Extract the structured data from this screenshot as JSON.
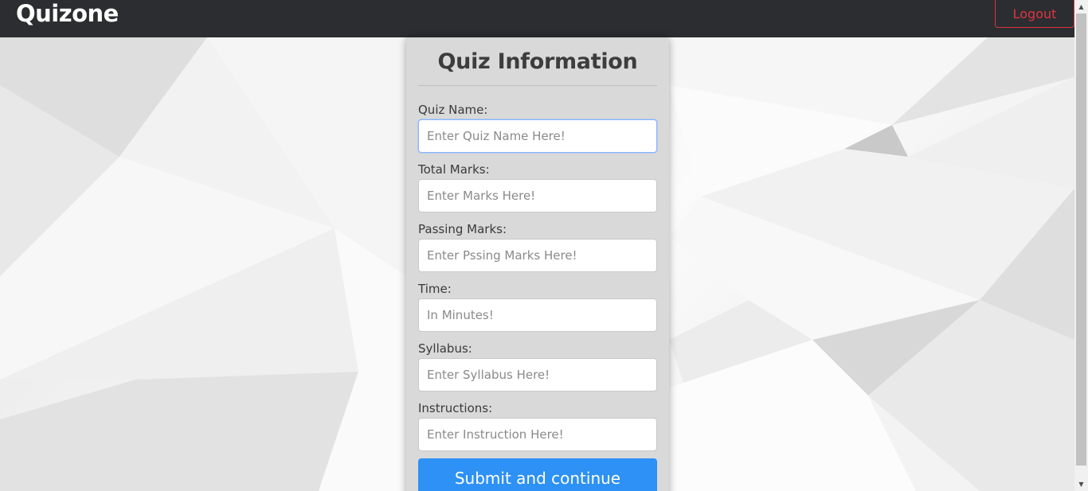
{
  "navbar": {
    "brand": "Quizone",
    "logout_label": "Logout",
    "logout_color": "#dc3545"
  },
  "form": {
    "title": "Quiz Information",
    "fields": [
      {
        "label": "Quiz Name:",
        "placeholder": "Enter Quiz Name Here!",
        "value": ""
      },
      {
        "label": "Total Marks:",
        "placeholder": "Enter Marks Here!",
        "value": ""
      },
      {
        "label": "Passing Marks:",
        "placeholder": "Enter Pssing Marks Here!",
        "value": ""
      },
      {
        "label": "Time:",
        "placeholder": "In Minutes!",
        "value": ""
      },
      {
        "label": "Syllabus:",
        "placeholder": "Enter Syllabus Here!",
        "value": ""
      },
      {
        "label": "Instructions:",
        "placeholder": "Enter Instruction Here!",
        "value": ""
      }
    ],
    "submit_label": "Submit and continue",
    "submit_color": "#2d91f5"
  },
  "icons": {
    "scroll_up": "scroll-up-arrow-icon",
    "scroll_down": "scroll-down-arrow-icon"
  }
}
